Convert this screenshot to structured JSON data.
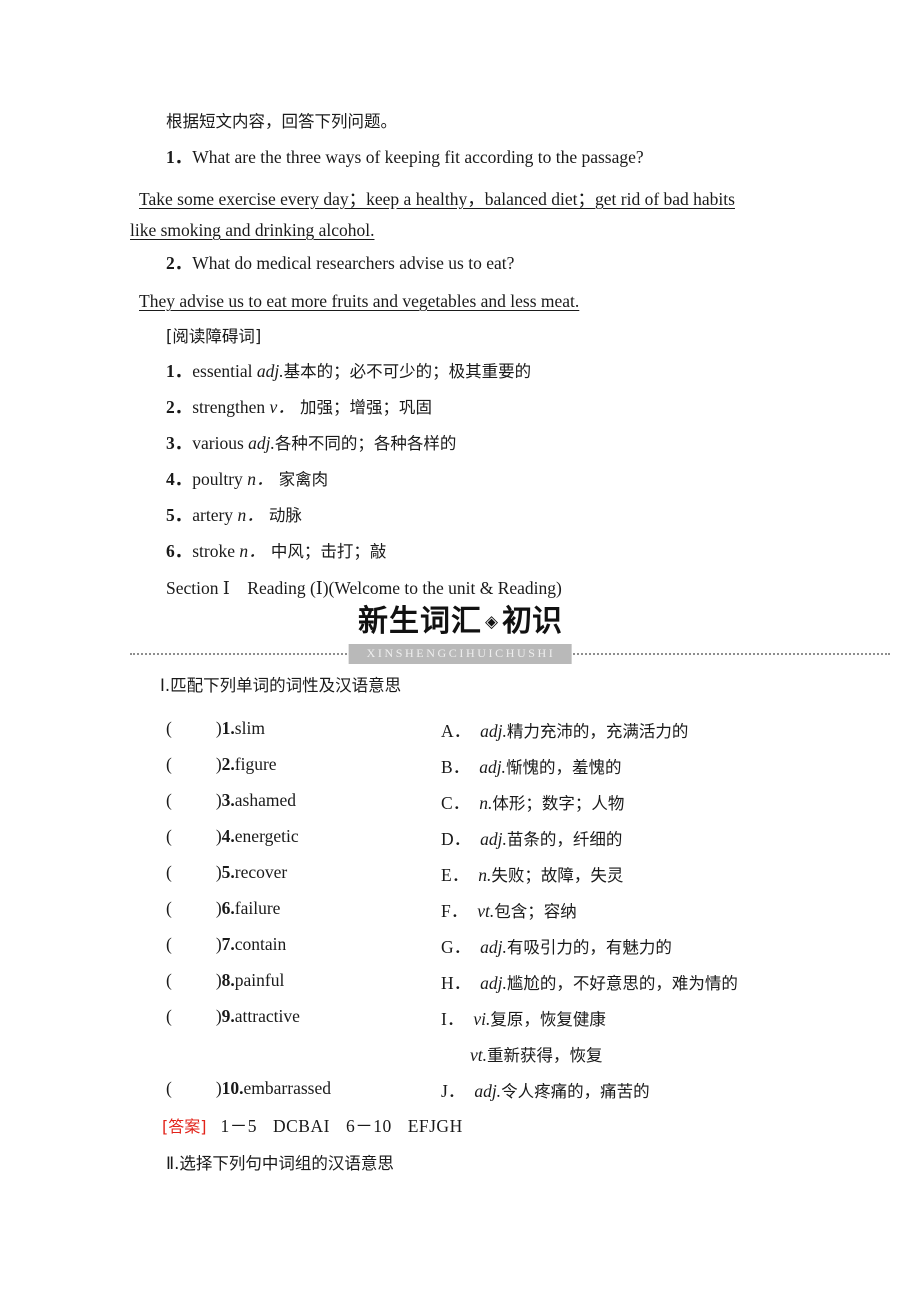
{
  "reading_check": {
    "prompt": "根据短文内容，回答下列问题。",
    "questions": [
      {
        "number": "1．",
        "question": "What are the three ways of keeping fit according to the passage?",
        "answer_line1": "Take some exercise every day；keep a healthy，balanced diet；get rid of bad habits",
        "answer_line2": "like smoking and drinking alcohol."
      },
      {
        "number": "2．",
        "question": "What do medical researchers advise us to eat?",
        "answer_line1": "They advise us to eat more fruits and vegetables and less meat."
      }
    ]
  },
  "hard_words": {
    "heading": "[阅读障碍词]",
    "items": [
      {
        "number": "1．",
        "word": "essential ",
        "pos": "adj.",
        "meaning": "基本的；必不可少的；极其重要的"
      },
      {
        "number": "2．",
        "word": "strengthen ",
        "pos": "v．",
        "meaning": " 加强；增强；巩固"
      },
      {
        "number": "3．",
        "word": "various ",
        "pos": "adj.",
        "meaning": "各种不同的；各种各样的"
      },
      {
        "number": "4．",
        "word": "poultry ",
        "pos": "n．",
        "meaning": " 家禽肉"
      },
      {
        "number": "5．",
        "word": "artery ",
        "pos": "n．",
        "meaning": " 动脉"
      },
      {
        "number": "6．",
        "word": "stroke ",
        "pos": "n．",
        "meaning": " 中风；击打；敲"
      }
    ]
  },
  "section_line": "Section Ⅰ　Reading (Ⅰ)(Welcome to the unit & Reading)",
  "banner": {
    "title_part1": "新生词汇",
    "diamond": "◈",
    "title_part2": "初识",
    "pinyin": "XINSHENGCIHUICHUSHI",
    "rule_color": "#8e8e8e",
    "pinyin_bg": "#b9b9b9"
  },
  "exercise1": {
    "heading": "Ⅰ.匹配下列单词的词性及汉语意思",
    "left_items": [
      {
        "paren_open": "(",
        "paren_close": ")",
        "number": "1.",
        "word": "slim"
      },
      {
        "paren_open": "(",
        "paren_close": ")",
        "number": "2.",
        "word": "figure"
      },
      {
        "paren_open": "(",
        "paren_close": ")",
        "number": "3.",
        "word": "ashamed"
      },
      {
        "paren_open": "(",
        "paren_close": ")",
        "number": "4.",
        "word": "energetic"
      },
      {
        "paren_open": "(",
        "paren_close": ")",
        "number": "5.",
        "word": "recover"
      },
      {
        "paren_open": "(",
        "paren_close": ")",
        "number": "6.",
        "word": "failure"
      },
      {
        "paren_open": "(",
        "paren_close": ")",
        "number": "7.",
        "word": "contain"
      },
      {
        "paren_open": "(",
        "paren_close": ")",
        "number": "8.",
        "word": "painful"
      },
      {
        "paren_open": "(",
        "paren_close": ")",
        "number": "9.",
        "word": "attractive"
      },
      {
        "paren_open": "(",
        "paren_close": ")",
        "number": "10.",
        "word": "embarrassed"
      }
    ],
    "right_items": [
      {
        "letter": "A．",
        "pos": "adj.",
        "meaning": "精力充沛的，充满活力的"
      },
      {
        "letter": "B．",
        "pos": "adj.",
        "meaning": "惭愧的，羞愧的"
      },
      {
        "letter": "C．",
        "pos": "n.",
        "meaning": "体形；数字；人物"
      },
      {
        "letter": "D．",
        "pos": "adj.",
        "meaning": "苗条的，纤细的"
      },
      {
        "letter": "E．",
        "pos": "n.",
        "meaning": "失败；故障，失灵"
      },
      {
        "letter": "F．",
        "pos": "vt.",
        "meaning": "包含；容纳"
      },
      {
        "letter": "G．",
        "pos": "adj.",
        "meaning": "有吸引力的，有魅力的"
      },
      {
        "letter": "H．",
        "pos": "adj.",
        "meaning": "尴尬的，不好意思的，难为情的"
      },
      {
        "letter": "I．",
        "pos": "vi.",
        "meaning": "复原，恢复健康"
      },
      {
        "letter": "",
        "pos": "vt.",
        "meaning": "重新获得，恢复"
      },
      {
        "letter": "J．",
        "pos": "adj.",
        "meaning": "令人疼痛的，痛苦的"
      }
    ],
    "answer": {
      "label": "[答案]",
      "range1": "1－5",
      "letters1": "DCBAI",
      "range2": "6－10",
      "letters2": "EFJGH",
      "label_color": "#e2231a"
    }
  },
  "exercise2": {
    "heading": "Ⅱ.选择下列句中词组的汉语意思"
  }
}
